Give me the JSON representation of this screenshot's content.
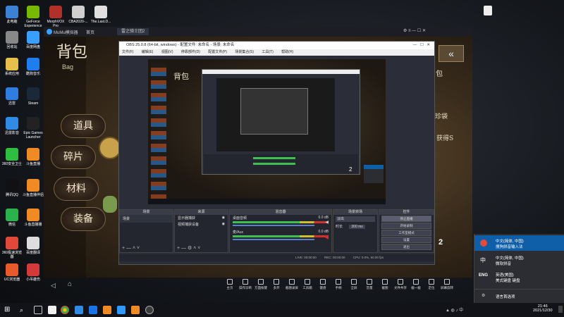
{
  "desktop_icons": [
    {
      "label": "此电脑",
      "color": "#3b82d6"
    },
    {
      "label": "GeForce Experience",
      "color": "#76b900"
    },
    {
      "label": "MorphVOX Pro",
      "color": "#b0302a"
    },
    {
      "label": "CBA2020-...",
      "color": "#cfcfcf"
    },
    {
      "label": "The.Last.D...",
      "color": "#e0e0e0"
    },
    {
      "label": "回收站",
      "color": "#888"
    },
    {
      "label": "百度网盘",
      "color": "#3aa0ff"
    },
    {
      "label": "系统应用",
      "color": "#e6c04a"
    },
    {
      "label": "酷狗音乐",
      "color": "#1e7ef0"
    },
    {
      "label": "迅雷",
      "color": "#2f7de1"
    },
    {
      "label": "Steam",
      "color": "#1b2838"
    },
    {
      "label": "迅雷影音",
      "color": "#2f8be6"
    },
    {
      "label": "Epic Games Launcher",
      "color": "#222"
    },
    {
      "label": "360安全卫士",
      "color": "#2fbf40"
    },
    {
      "label": "斗鱼直播",
      "color": "#f08a24"
    },
    {
      "label": "腾讯QQ",
      "color": "#111"
    },
    {
      "label": "斗鱼直播伴侣",
      "color": "#f08a24"
    },
    {
      "label": "微信",
      "color": "#2ab24b"
    },
    {
      "label": "斗鱼直播播",
      "color": "#f08a24"
    },
    {
      "label": "360极速浏览器",
      "color": "#e0483a"
    },
    {
      "label": "百度翻译",
      "color": "#ddd"
    },
    {
      "label": "UC浏览器",
      "color": "#e85a2a"
    },
    {
      "label": "小吊雄伤",
      "color": "#d43a3a"
    }
  ],
  "emulator": {
    "app_name": "MuMu模拟器",
    "tab_home": "首页",
    "game_tab": "雷之骑士团2",
    "bag_title": "背包",
    "bag_subtitle": "Bag",
    "side_menu": [
      "道具",
      "碎片",
      "材料",
      "装备"
    ],
    "right_text_1": "包",
    "right_text_2": "珍袋",
    "right_text_3": "获得S",
    "page_number": "2",
    "tools": [
      "主页",
      "操作诊断",
      "方面按键",
      "多开",
      "截图录屏",
      "工具箱",
      "键盘",
      "手柄",
      "全屏",
      "音量",
      "截图",
      "文件共享",
      "截一截",
      "定位",
      "屏幕旋转"
    ]
  },
  "obs": {
    "window_title": "OBS 25.0.8 (64-bit, windows) - 配置文件: 未命名 - 场景: 未命名",
    "menu": [
      "文件(F)",
      "编辑(E)",
      "视图(V)",
      "停靠部件(D)",
      "配置文件(P)",
      "场景集合(S)",
      "工具(T)",
      "帮助(H)"
    ],
    "docks": {
      "scenes": {
        "title": "场景",
        "items": [
          "场景"
        ]
      },
      "sources": {
        "title": "来源",
        "items": [
          "显示器捕获",
          "视频捕获设备"
        ]
      },
      "mixer": {
        "title": "混音器",
        "channels": [
          "桌面音频",
          "麦/Aux"
        ],
        "level_labels": [
          "0.0 dB",
          "0.0 dB"
        ]
      },
      "transitions": {
        "title": "场景转场",
        "type": "淡出",
        "duration_label": "时长",
        "duration": "300 ms"
      },
      "controls": {
        "title": "控件",
        "buttons": [
          "停止直播",
          "开始录制",
          "工作室模式",
          "设置",
          "退出"
        ]
      }
    },
    "status": {
      "live": "LIVE: 00:00:00",
      "rec": "REC: 00:00:00",
      "cpu": "CPU: 0.0%, 60.00 fps"
    }
  },
  "ime_menu": {
    "items": [
      {
        "code": "中",
        "line1": "中文(简体, 中国)",
        "line2": "搜狗拼音输入法",
        "selected": true
      },
      {
        "code": "中",
        "line1": "中文(简体, 中国)",
        "line2": "微软拼音",
        "selected": false
      },
      {
        "code": "ENG",
        "line1": "英语(美国)",
        "line2": "美式键盘 键盘",
        "selected": false
      }
    ],
    "footer": "语言首选项"
  },
  "taskbar": {
    "time": "21:46",
    "date": "2021/12/30",
    "search_placeholder": ""
  },
  "colors": {
    "accent": "#0f5ea8",
    "obs_bg": "#2b2e38",
    "meter_green": "#3fbf4f",
    "meter_red": "#d03030"
  }
}
